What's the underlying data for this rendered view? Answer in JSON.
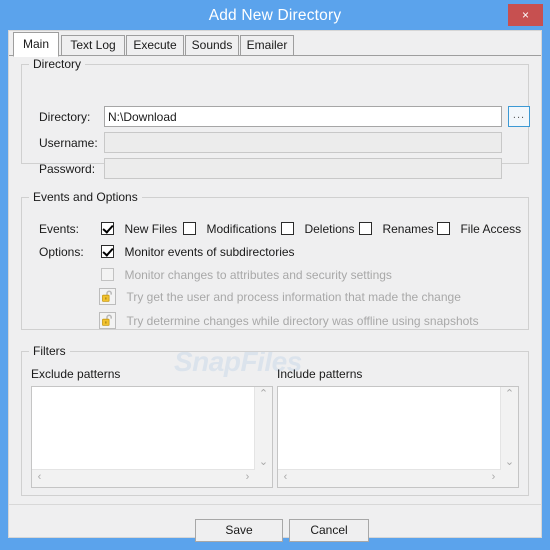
{
  "window": {
    "title": "Add New Directory",
    "close_label": "×",
    "title_bar_color": "#5ba3ec",
    "close_button_color": "#c75050"
  },
  "tabs": [
    {
      "label": "Main",
      "active": true
    },
    {
      "label": "Text Log",
      "active": false
    },
    {
      "label": "Execute",
      "active": false
    },
    {
      "label": "Sounds",
      "active": false
    },
    {
      "label": "Emailer",
      "active": false
    }
  ],
  "directory_group": {
    "legend": "Directory",
    "fields": [
      {
        "label": "Directory:",
        "value": "N:\\Download",
        "placeholder": "",
        "disabled": false
      },
      {
        "label": "Username:",
        "value": "",
        "placeholder": "",
        "disabled": true
      },
      {
        "label": "Password:",
        "value": "",
        "placeholder": "",
        "disabled": true
      }
    ],
    "browse_label": "..."
  },
  "events_group": {
    "legend": "Events and Options",
    "events_label": "Events:",
    "events": [
      {
        "label": "New Files",
        "checked": true
      },
      {
        "label": "Modifications",
        "checked": false
      },
      {
        "label": "Deletions",
        "checked": false
      },
      {
        "label": "Renames",
        "checked": false
      },
      {
        "label": "File Access",
        "checked": false
      }
    ],
    "options_label": "Options:",
    "options": [
      {
        "label": "Monitor events of subdirectories",
        "checked": true,
        "disabled": false
      },
      {
        "label": "Monitor changes to attributes and security settings",
        "checked": false,
        "disabled": true
      }
    ],
    "locked_options": [
      {
        "label": "Try get the user and process information that made the change",
        "icon": "unlocked-padlock-icon"
      },
      {
        "label": "Try determine changes while directory was offline using snapshots",
        "icon": "unlocked-padlock-icon"
      }
    ]
  },
  "filters_group": {
    "legend": "Filters",
    "exclude_label": "Exclude patterns",
    "exclude_value": "",
    "include_label": "Include patterns",
    "include_value": "",
    "scroll_up": "⌃",
    "scroll_down": "⌄",
    "scroll_left": "‹",
    "scroll_right": "›"
  },
  "footer": {
    "save_label": "Save",
    "cancel_label": "Cancel"
  },
  "watermark": {
    "text": "SnapFiles"
  }
}
